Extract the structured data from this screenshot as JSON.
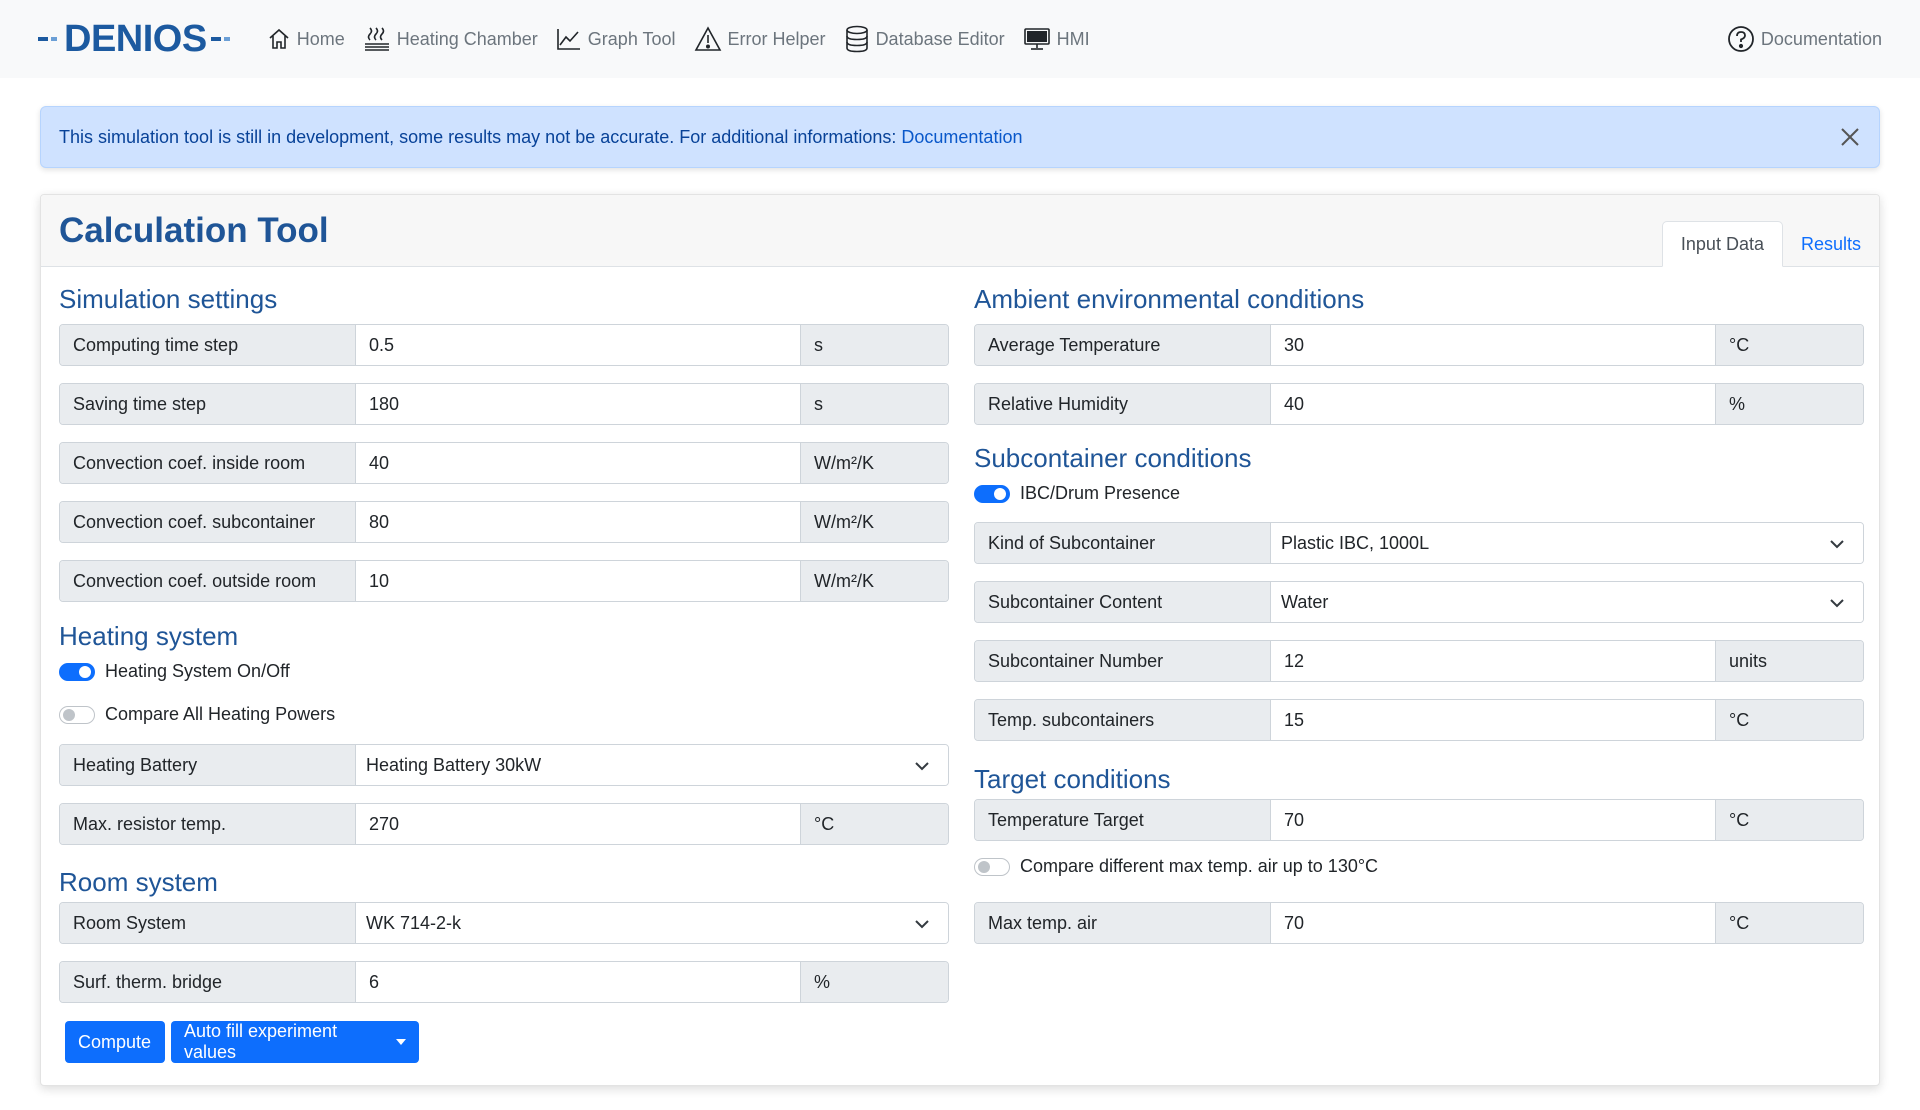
{
  "brand": {
    "name": "DENIOS"
  },
  "nav": {
    "items": [
      {
        "label": "Home",
        "icon": "home-icon"
      },
      {
        "label": "Heating Chamber",
        "icon": "heater-icon"
      },
      {
        "label": "Graph Tool",
        "icon": "chart-line-icon"
      },
      {
        "label": "Error Helper",
        "icon": "warning-icon"
      },
      {
        "label": "Database Editor",
        "icon": "database-icon"
      },
      {
        "label": "HMI",
        "icon": "monitor-icon"
      }
    ],
    "documentation": "Documentation"
  },
  "alert": {
    "text": "This simulation tool is still in development, some results may not be accurate. For additional informations:",
    "link": "Documentation"
  },
  "card": {
    "title": "Calculation Tool",
    "tabs": {
      "input": "Input Data",
      "results": "Results"
    }
  },
  "simulation": {
    "title": "Simulation settings",
    "rows": [
      {
        "label": "Computing time step",
        "value": "0.5",
        "unit": "s"
      },
      {
        "label": "Saving time step",
        "value": "180",
        "unit": "s"
      },
      {
        "label": "Convection coef. inside room",
        "value": "40",
        "unit": "W/m²/K"
      },
      {
        "label": "Convection coef. subcontainer",
        "value": "80",
        "unit": "W/m²/K"
      },
      {
        "label": "Convection coef. outside room",
        "value": "10",
        "unit": "W/m²/K"
      }
    ]
  },
  "heating": {
    "title": "Heating system",
    "switch_onoff": "Heating System On/Off",
    "switch_compare": "Compare All Heating Powers",
    "battery_label": "Heating Battery",
    "battery_value": "Heating Battery 30kW",
    "resistor_label": "Max. resistor temp.",
    "resistor_value": "270",
    "resistor_unit": "°C"
  },
  "room": {
    "title": "Room system",
    "system_label": "Room System",
    "system_value": "WK 714-2-k",
    "bridge_label": "Surf. therm. bridge",
    "bridge_value": "6",
    "bridge_unit": "%"
  },
  "buttons": {
    "compute": "Compute",
    "autofill": "Auto fill experiment values"
  },
  "ambient": {
    "title": "Ambient environmental conditions",
    "rows": [
      {
        "label": "Average Temperature",
        "value": "30",
        "unit": "°C"
      },
      {
        "label": "Relative Humidity",
        "value": "40",
        "unit": "%"
      }
    ]
  },
  "subcontainer": {
    "title": "Subcontainer conditions",
    "switch_presence": "IBC/Drum Presence",
    "kind_label": "Kind of Subcontainer",
    "kind_value": "Plastic IBC, 1000L",
    "content_label": "Subcontainer Content",
    "content_value": "Water",
    "number_label": "Subcontainer Number",
    "number_value": "12",
    "number_unit": "units",
    "temp_label": "Temp. subcontainers",
    "temp_value": "15",
    "temp_unit": "°C"
  },
  "target": {
    "title": "Target conditions",
    "temp_label": "Temperature Target",
    "temp_value": "70",
    "temp_unit": "°C",
    "switch_compare": "Compare different max temp. air up to 130°C",
    "maxair_label": "Max temp. air",
    "maxair_value": "70",
    "maxair_unit": "°C"
  },
  "colors": {
    "primary": "#0d6efd",
    "heading": "#1f5597",
    "alert_bg": "#cfe2ff"
  }
}
